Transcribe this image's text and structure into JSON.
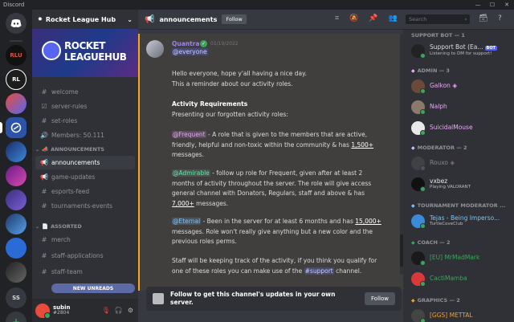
{
  "window": {
    "title": "Discord"
  },
  "rail": {
    "home_icon": "discord-logo-icon",
    "servers": [
      "RLU",
      "RL",
      "",
      "",
      "",
      "",
      "",
      "",
      "",
      "",
      "",
      "SS"
    ],
    "add_label": "+"
  },
  "guild": {
    "name": "Rocket League Hub",
    "banner_line1": "ROCKET",
    "banner_line2": "LEAGUEHUB",
    "channels": {
      "welcome": "welcome",
      "server_rules": "server-rules",
      "set_roles": "set-roles",
      "members": "Members: 50.111",
      "cat_announcements": "ANNOUNCEMENTS",
      "announcements": "announcements",
      "game_updates": "game-updates",
      "esports_feed": "esports-feed",
      "tournaments_events": "tournaments-events",
      "cat_assorted": "ASSORTED",
      "merch": "merch",
      "staff_applications": "staff-applications",
      "staff_team": "staff-team"
    },
    "new_unreads": "NEW UNREADS"
  },
  "user": {
    "name": "subin",
    "tag": "#2804"
  },
  "topbar": {
    "channel": "announcements",
    "follow": "Follow",
    "search_placeholder": "Search"
  },
  "message": {
    "author": "Quantra",
    "timestamp": "01/19/2022",
    "mention": "@everyone",
    "line1": "Hello everyone, hope y'all having a nice day.",
    "line2": "This a reminder about our activity roles.",
    "heading": "Activity Requirements",
    "line3": "Presenting our forgotten activity roles:",
    "freq_role": "@Frequent",
    "freq_text_a": " - A role that is given to the members that are active,",
    "freq_text_b": "friendly, helpful and non-toxic within the community & has ",
    "freq_count": "1,500+",
    "freq_text_c": "messages.",
    "adm_role": "@Admirable",
    "adm_text_a": " - follow up role for Frequent, given after at least 2",
    "adm_text_b": "months of activity throughout the server. The role will give access",
    "adm_text_c": "general channel with Donators, Regulars, staff and above & has",
    "adm_count": "7,000+",
    "adm_text_d": " messages.",
    "ete_role": "@Eternal",
    "ete_text_a": " - Been in the server for at least 6 months and has ",
    "ete_count": "15,000+",
    "ete_text_b": "messages. Role won't really give anything but a new color and the",
    "ete_text_c": "previous roles perms.",
    "staff_a": "Staff will be keeping track of the activity, if you think you qualify for",
    "staff_b": "one of these roles you can make use of the ",
    "support_ch": "#support",
    "staff_c": " channel."
  },
  "followbar": {
    "text": "Follow to get this channel's updates in your own server.",
    "button": "Follow"
  },
  "members": {
    "support_bot_head": "SUPPORT BOT — 1",
    "support_bot_name": "Support Bot (Ea...",
    "support_bot_badge": "BOT",
    "support_bot_status": "Listening to DM for support!",
    "admin_head": "ADMIN — 3",
    "admin1": "Galkon",
    "admin2": "Nalph",
    "admin3": "SuicidalMouse",
    "mod_head": "MODERATOR — 2",
    "mod1": "Rouxo",
    "mod2": "vxbez",
    "mod2_status": "Playing VALORANT",
    "tmod_head": "TOURNAMENT MODERATOR ...",
    "tmod1": "Tejas - Being Imperso...",
    "tmod1_status": "TurtleCoveClub",
    "coach_head": "COACH — 2",
    "coach1": "[EU] MrMadMark",
    "coach2": "CactiMamba",
    "gfx_head": "GRAPHICS — 2",
    "gfx1": "[GGS] METTAL"
  },
  "colors": {
    "accent": "#5865f2",
    "admin": "#e9a8f8",
    "mod": "#e9e9e9",
    "coach": "#3ba55c",
    "announce_bar": "#faa61a"
  }
}
